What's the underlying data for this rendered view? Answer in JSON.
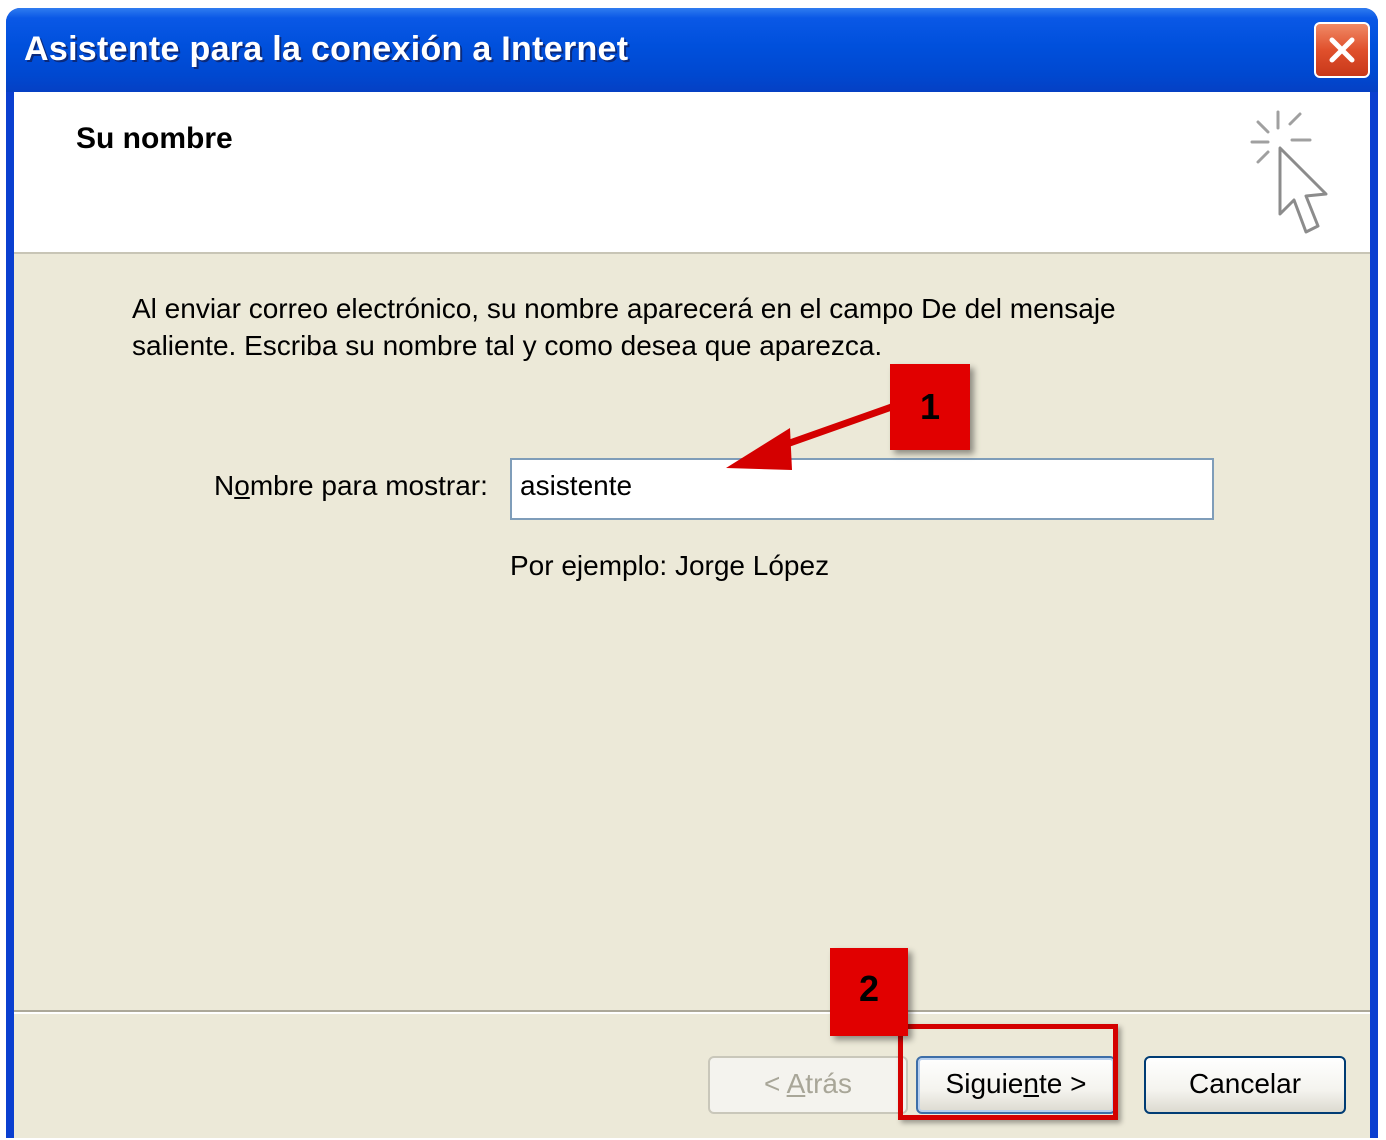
{
  "window": {
    "title": "Asistente para la conexión a Internet",
    "close_icon": "close-icon"
  },
  "header": {
    "title": "Su nombre",
    "icon": "wizard-cursor-icon"
  },
  "body": {
    "description": "Al enviar correo electrónico, su nombre aparecerá en el campo De del mensaje saliente. Escriba su nombre tal y como desea que aparezca.",
    "field_label_pre": "N",
    "field_label_accel": "o",
    "field_label_post": "mbre para mostrar:",
    "field_value": "asistente",
    "example_text": "Por ejemplo: Jorge López"
  },
  "buttons": {
    "back_pre": "< ",
    "back_accel": "A",
    "back_post": "trás",
    "next_pre": "Siguie",
    "next_accel": "n",
    "next_post": "te >",
    "cancel_label": "Cancelar"
  },
  "annotations": {
    "badge_1": "1",
    "badge_2": "2",
    "color": "#e10000"
  },
  "colors": {
    "titlebar": "#0050dc",
    "dialog_bg": "#ece9d8",
    "input_border": "#7f9db9"
  }
}
